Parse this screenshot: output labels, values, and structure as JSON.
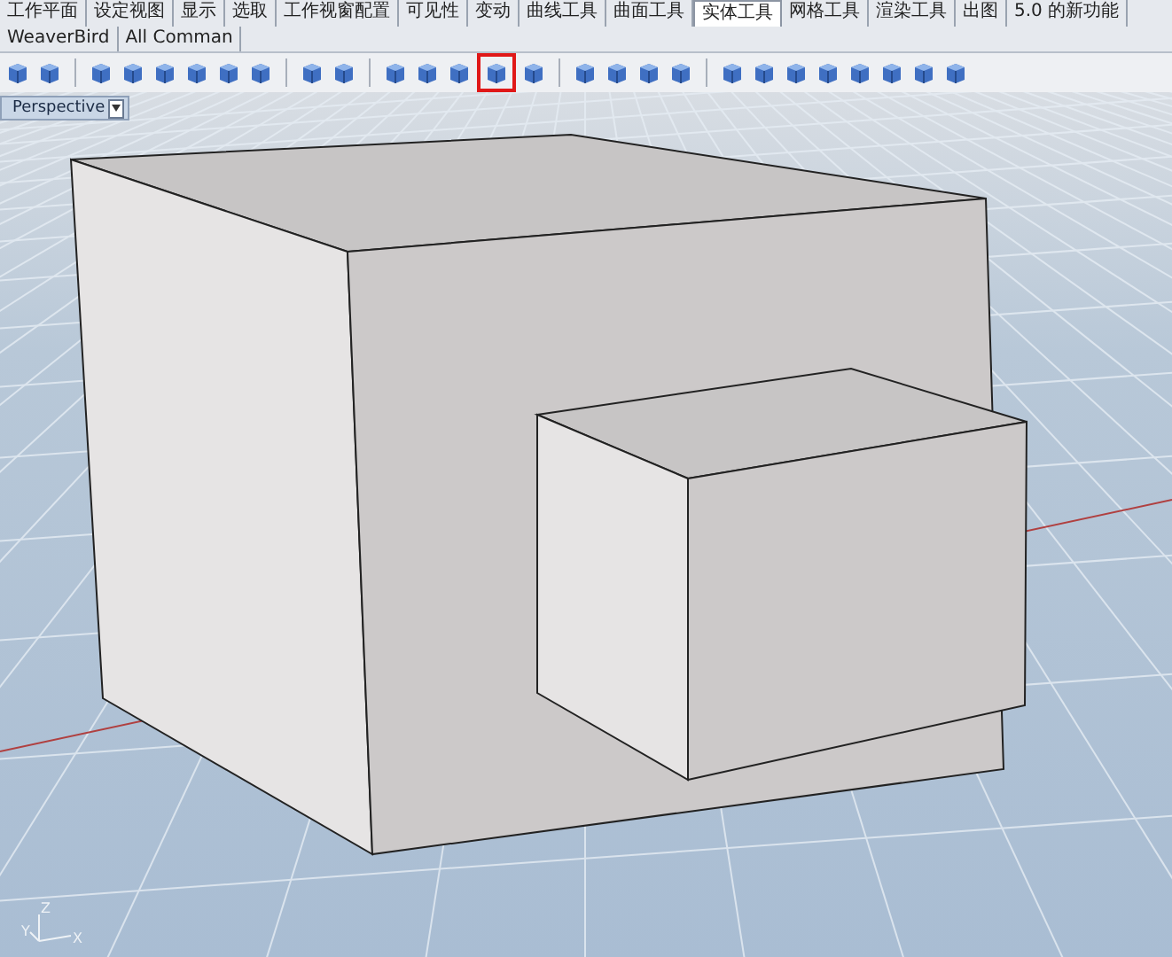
{
  "tabs": [
    {
      "label": "工作平面",
      "selected": false
    },
    {
      "label": "设定视图",
      "selected": false
    },
    {
      "label": "显示",
      "selected": false
    },
    {
      "label": "选取",
      "selected": false
    },
    {
      "label": "工作视窗配置",
      "selected": false
    },
    {
      "label": "可见性",
      "selected": false
    },
    {
      "label": "变动",
      "selected": false
    },
    {
      "label": "曲线工具",
      "selected": false
    },
    {
      "label": "曲面工具",
      "selected": false
    },
    {
      "label": "实体工具",
      "selected": true
    },
    {
      "label": "网格工具",
      "selected": false
    },
    {
      "label": "渲染工具",
      "selected": false
    },
    {
      "label": "出图",
      "selected": false
    },
    {
      "label": "5.0 的新功能",
      "selected": false
    },
    {
      "label": "WeaverBird",
      "selected": false
    },
    {
      "label": "All Comman",
      "selected": false
    }
  ],
  "toolbar": [
    {
      "kind": "tool",
      "highlighted": false
    },
    {
      "kind": "tool",
      "highlighted": false
    },
    {
      "kind": "separator"
    },
    {
      "kind": "tool",
      "highlighted": false
    },
    {
      "kind": "tool",
      "highlighted": false
    },
    {
      "kind": "tool",
      "highlighted": false
    },
    {
      "kind": "tool",
      "highlighted": false
    },
    {
      "kind": "tool",
      "highlighted": false
    },
    {
      "kind": "tool",
      "highlighted": false
    },
    {
      "kind": "separator"
    },
    {
      "kind": "tool",
      "highlighted": false
    },
    {
      "kind": "tool",
      "highlighted": false
    },
    {
      "kind": "separator"
    },
    {
      "kind": "tool",
      "highlighted": false
    },
    {
      "kind": "tool",
      "highlighted": false
    },
    {
      "kind": "tool",
      "highlighted": false
    },
    {
      "kind": "tool",
      "highlighted": true
    },
    {
      "kind": "tool",
      "highlighted": false
    },
    {
      "kind": "separator"
    },
    {
      "kind": "tool",
      "highlighted": false
    },
    {
      "kind": "tool",
      "highlighted": false
    },
    {
      "kind": "tool",
      "highlighted": false
    },
    {
      "kind": "tool",
      "highlighted": false
    },
    {
      "kind": "separator"
    },
    {
      "kind": "tool",
      "highlighted": false
    },
    {
      "kind": "tool",
      "highlighted": false
    },
    {
      "kind": "tool",
      "highlighted": false
    },
    {
      "kind": "tool",
      "highlighted": false
    },
    {
      "kind": "tool",
      "highlighted": false
    },
    {
      "kind": "tool",
      "highlighted": false
    },
    {
      "kind": "tool",
      "highlighted": false
    },
    {
      "kind": "tool",
      "highlighted": false
    }
  ],
  "viewport": {
    "title": "Perspective",
    "axes": {
      "z": "Z",
      "y": "Y",
      "x": "X"
    }
  }
}
